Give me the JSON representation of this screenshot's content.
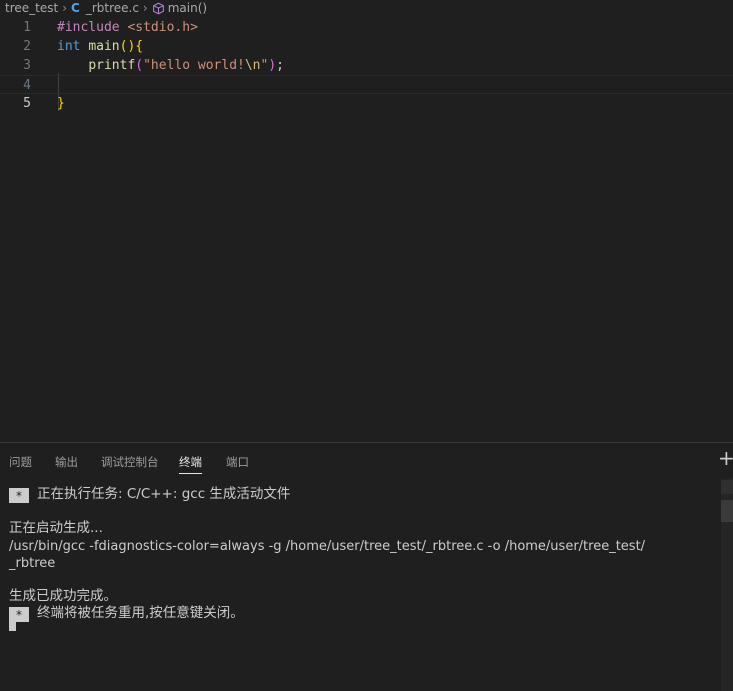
{
  "breadcrumb": {
    "folder": "tree_test",
    "file_icon_letter": "C",
    "file": "_rbtree.c",
    "symbol": "main()"
  },
  "editor": {
    "line_numbers": [
      "1",
      "2",
      "3",
      "4",
      "5"
    ],
    "current_line": 4,
    "lines": [
      {
        "tokens": [
          [
            "pre",
            "#include "
          ],
          [
            "str",
            "<stdio.h>"
          ]
        ]
      },
      {
        "tokens": [
          [
            "kw",
            "int "
          ],
          [
            "fn",
            "main"
          ],
          [
            "br",
            "()"
          ],
          [
            "br",
            "{"
          ]
        ]
      },
      {
        "tokens": [
          [
            "sp",
            "    "
          ],
          [
            "fn",
            "printf"
          ],
          [
            "br2",
            "("
          ],
          [
            "str",
            "\"hello world!"
          ],
          [
            "esc",
            "\\n"
          ],
          [
            "str",
            "\""
          ],
          [
            "br2",
            ")"
          ],
          [
            "punc",
            ";"
          ]
        ]
      },
      {
        "tokens": []
      },
      {
        "tokens": [
          [
            "br",
            "}"
          ]
        ]
      }
    ]
  },
  "panel": {
    "tabs": [
      "问题",
      "输出",
      "调试控制台",
      "终端",
      "端口"
    ],
    "active_tab": "终端",
    "add_label": "+"
  },
  "terminal": {
    "badge": "*",
    "task_line": "正在执行任务: C/C++: gcc 生成活动文件",
    "starting": "正在启动生成...",
    "command_1": "/usr/bin/gcc -fdiagnostics-color=always -g /home/user/tree_test/_rbtree.c -o /home/user/tree_test/",
    "command_2": "_rbtree",
    "done": "生成已成功完成。",
    "reuse_note": "终端将被任务重用,按任意键关闭。"
  },
  "colors": {
    "background": "#1f1f1f",
    "keyword": "#569cd6",
    "function": "#dcdcaa",
    "string": "#ce9178",
    "preprocessor": "#c586c0",
    "bracket": "#ffd700"
  }
}
